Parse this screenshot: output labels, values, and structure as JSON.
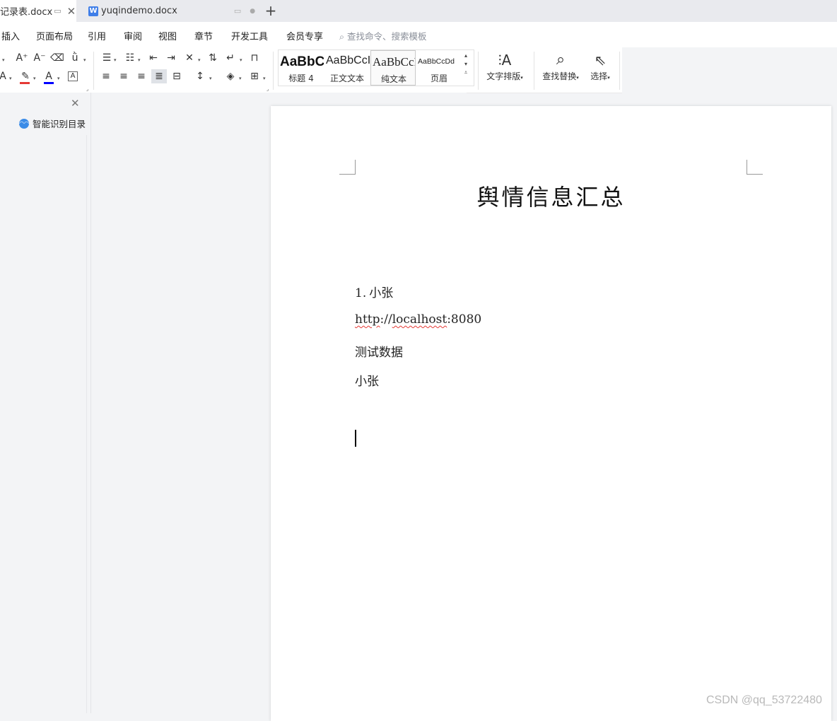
{
  "tabs": {
    "active_title": "记录表.docx",
    "inactive_title": "yuqindemo.docx",
    "doc_icon_letter": "W",
    "new_tab_label": "+"
  },
  "menu": {
    "items": [
      "插入",
      "页面布局",
      "引用",
      "审阅",
      "视图",
      "章节",
      "开发工具",
      "会员专享"
    ],
    "search_placeholder": "查找命令、搜索模板"
  },
  "styles": {
    "items": [
      {
        "sample": "AaBbC",
        "label": "标题 4"
      },
      {
        "sample": "AaBbCcI",
        "label": "正文文本"
      },
      {
        "sample": "AaBbCcI",
        "label": "纯文本"
      },
      {
        "sample": "AaBbCcDd",
        "label": "页眉"
      }
    ]
  },
  "ribbon": {
    "text_layout_label": "文字排版",
    "find_replace_label": "查找替换",
    "select_label": "选择",
    "font_color": "#0000ff",
    "highlight_color": "#e53935"
  },
  "left_panel": {
    "smart_toc_label": "智能识别目录"
  },
  "document": {
    "title": "舆情信息汇总",
    "lines": [
      {
        "prefix": "1.",
        "text": "小张"
      },
      {
        "url_a": "http",
        "url_sep": "://",
        "url_b": "localhost",
        "url_port": ":8080"
      },
      {
        "text": "测试数据"
      },
      {
        "text": "小张"
      }
    ]
  },
  "watermark": "CSDN @qq_53722480"
}
